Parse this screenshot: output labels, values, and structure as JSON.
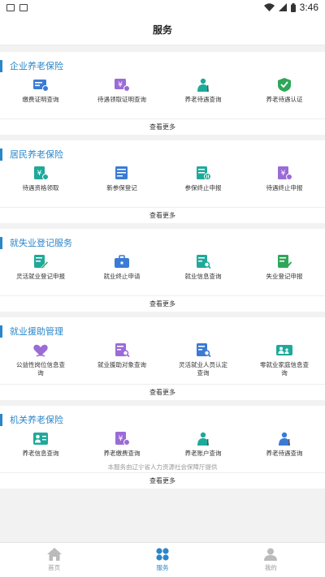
{
  "status_bar": {
    "time": "3:46"
  },
  "header": {
    "title": "服务"
  },
  "sections": [
    {
      "title": "企业养老保险",
      "items": [
        {
          "label": "缴费证明查询",
          "icon": "bill-card-icon",
          "color": "#3a7bd5"
        },
        {
          "label": "待遇领取证明查询",
          "icon": "yuan-card-icon",
          "color": "#9b6bd6"
        },
        {
          "label": "养老待遇查询",
          "icon": "elder-person-icon",
          "color": "#1fa99a"
        },
        {
          "label": "养老待遇认证",
          "icon": "shield-check-icon",
          "color": "#2fa65a"
        }
      ],
      "more": "查看更多"
    },
    {
      "title": "居民养老保险",
      "items": [
        {
          "label": "待遇资格领取",
          "icon": "yuan-doc-icon",
          "color": "#1fa99a"
        },
        {
          "label": "新参保登记",
          "icon": "form-doc-icon",
          "color": "#3a7bd5"
        },
        {
          "label": "参保终止申报",
          "icon": "pause-doc-icon",
          "color": "#1fa99a"
        },
        {
          "label": "待遇终止申报",
          "icon": "yuan-stop-icon",
          "color": "#9b6bd6"
        }
      ],
      "more": "查看更多"
    },
    {
      "title": "就失业登记服务",
      "items": [
        {
          "label": "灵活就业登记申报",
          "icon": "edit-doc-icon",
          "color": "#1fa99a"
        },
        {
          "label": "就业终止申请",
          "icon": "briefcase-icon",
          "color": "#3a7bd5"
        },
        {
          "label": "就业信息查询",
          "icon": "search-doc-icon",
          "color": "#1fa99a"
        },
        {
          "label": "失业登记申报",
          "icon": "check-doc-icon",
          "color": "#2fa65a"
        }
      ],
      "more": "查看更多"
    },
    {
      "title": "就业援助管理",
      "items": [
        {
          "label": "公益性岗位信息查询",
          "icon": "heart-hands-icon",
          "color": "#9b6bd6"
        },
        {
          "label": "就业援助对象查询",
          "icon": "search-list-icon",
          "color": "#9b6bd6"
        },
        {
          "label": "灵活就业人员认定查询",
          "icon": "search-doc-icon",
          "color": "#3a7bd5"
        },
        {
          "label": "零就业家庭信息查询",
          "icon": "family-card-icon",
          "color": "#1fa99a"
        }
      ],
      "more": "查看更多"
    },
    {
      "title": "机关养老保险",
      "items": [
        {
          "label": "养老信息查询",
          "icon": "person-list-icon",
          "color": "#1fa99a"
        },
        {
          "label": "养老缴费查询",
          "icon": "yuan-doc-icon",
          "color": "#9b6bd6"
        },
        {
          "label": "养老账户查询",
          "icon": "elder-person-icon",
          "color": "#1fa99a"
        },
        {
          "label": "养老待遇查询",
          "icon": "elder-person-icon",
          "color": "#3a7bd5"
        }
      ],
      "more": "查看更多"
    }
  ],
  "footnote": "本服务由辽宁省人力资源社会保障厅提供",
  "tabs": [
    {
      "label": "首页",
      "icon": "home-icon",
      "active": false
    },
    {
      "label": "服务",
      "icon": "grid-dots-icon",
      "active": true
    },
    {
      "label": "我的",
      "icon": "user-icon",
      "active": false
    }
  ],
  "colors": {
    "accent": "#2b86c9",
    "inactive": "#bbbbbb"
  }
}
